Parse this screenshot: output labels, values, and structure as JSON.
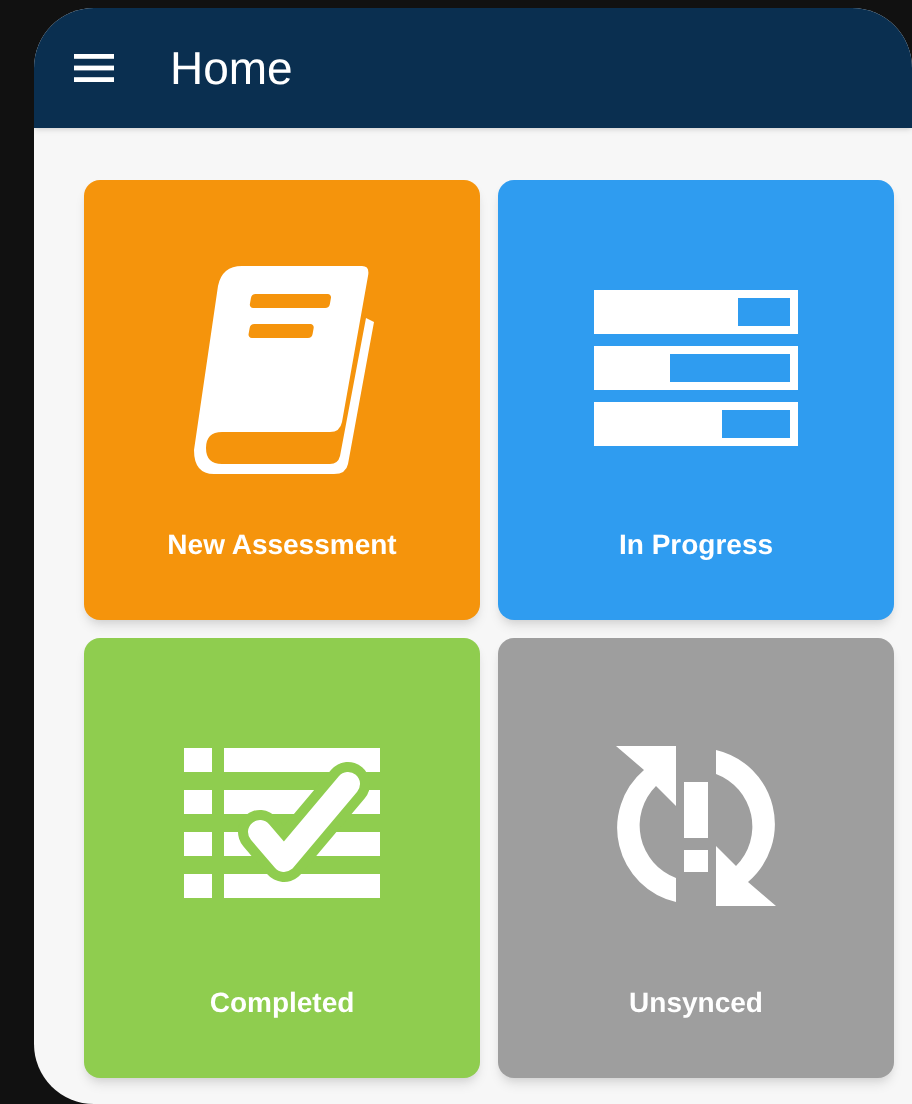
{
  "app_bar": {
    "title": "Home"
  },
  "tiles": [
    {
      "label": "New Assessment",
      "kind": "book",
      "color": "#f5940c"
    },
    {
      "label": "In Progress",
      "kind": "progress",
      "color": "#2f9cf0"
    },
    {
      "label": "Completed",
      "kind": "checklist",
      "color": "#8fcd4f"
    },
    {
      "label": "Unsynced",
      "kind": "sync",
      "color": "#9e9e9e"
    }
  ]
}
